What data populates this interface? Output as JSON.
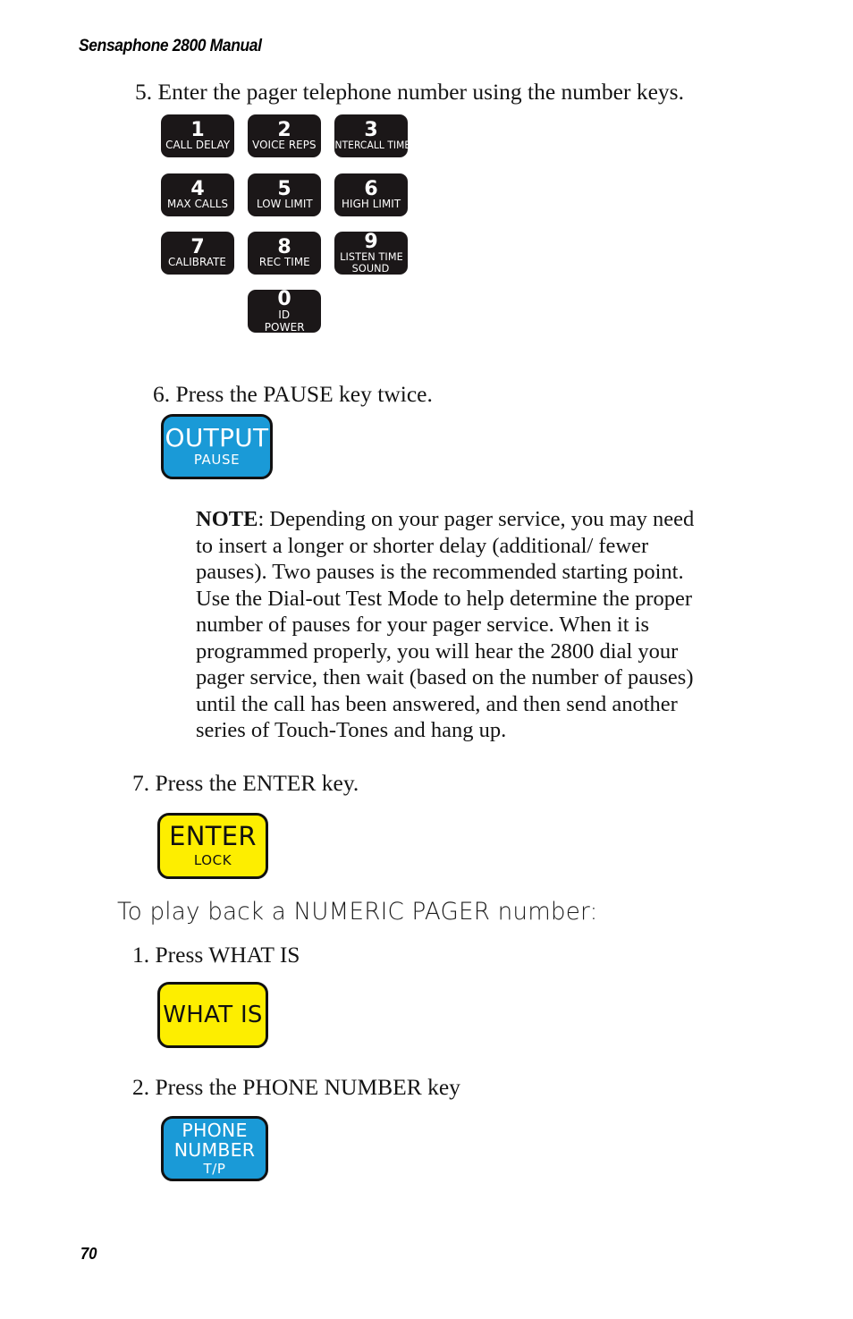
{
  "document": {
    "running_header": "Sensaphone 2800 Manual",
    "page_number": "70"
  },
  "steps": {
    "step5": "5. Enter the pager telephone number using the number keys.",
    "step6": "6. Press the PAUSE key twice.",
    "step7": "7. Press the ENTER key.",
    "playback_step1": "1. Press WHAT IS",
    "playback_step2": "2. Press the PHONE NUMBER key"
  },
  "section_heading": "To play back a NUMERIC PAGER number:",
  "note": {
    "label": "NOTE",
    "body": ": Depending on your pager service, you may need to insert a longer or shorter delay (additional/ fewer pauses). Two pauses is the recommended starting point. Use the Dial-out Test Mode to help determine the proper number of pauses for your pager service.  When it is programmed properly, you will hear the 2800 dial your pager service, then wait (based on the number of pauses) until the call has been answered, and then send another series of Touch-Tones and hang up."
  },
  "keypad": {
    "keys": [
      {
        "digit": "1",
        "sub1": "CALL DELAY",
        "sub2": ""
      },
      {
        "digit": "2",
        "sub1": "VOICE REPS",
        "sub2": ""
      },
      {
        "digit": "3",
        "sub1": "INTERCALL TIME",
        "sub2": ""
      },
      {
        "digit": "4",
        "sub1": "MAX CALLS",
        "sub2": ""
      },
      {
        "digit": "5",
        "sub1": "LOW LIMIT",
        "sub2": ""
      },
      {
        "digit": "6",
        "sub1": "HIGH LIMIT",
        "sub2": ""
      },
      {
        "digit": "7",
        "sub1": "CALIBRATE",
        "sub2": ""
      },
      {
        "digit": "8",
        "sub1": "REC TIME",
        "sub2": ""
      },
      {
        "digit": "9",
        "sub1": "LISTEN TIME",
        "sub2": "SOUND"
      },
      {
        "digit": "0",
        "sub1": "ID",
        "sub2": "POWER"
      }
    ]
  },
  "function_keys": {
    "output": {
      "main": "OUTPUT",
      "subline": "PAUSE"
    },
    "enter": {
      "main": "ENTER",
      "subline": "LOCK"
    },
    "whatis": {
      "main": "WHAT IS",
      "subline": ""
    },
    "phone": {
      "line1": "PHONE",
      "line2": "NUMBER",
      "subline": "T/P"
    }
  },
  "colors": {
    "key_black": "#1b1718",
    "key_blue": "#1a9ad7",
    "key_yellow": "#fdee00",
    "outline": "#111111",
    "text": "#141414",
    "page_bg": "#ffffff"
  }
}
